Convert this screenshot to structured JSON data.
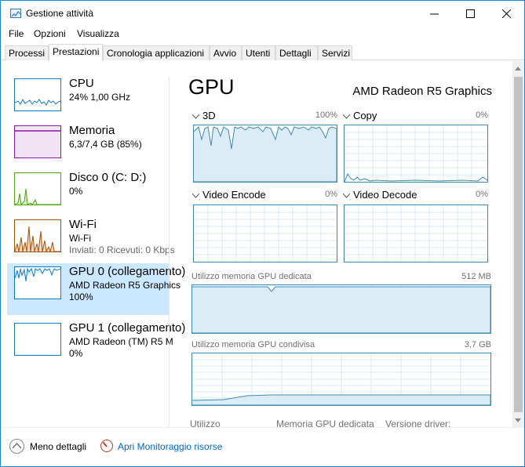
{
  "window": {
    "title": "Gestione attività"
  },
  "menu": [
    "File",
    "Opzioni",
    "Visualizza"
  ],
  "tabs": [
    "Processi",
    "Prestazioni",
    "Cronologia applicazioni",
    "Avvio",
    "Utenti",
    "Dettagli",
    "Servizi"
  ],
  "active_tab": "Prestazioni",
  "resources": [
    {
      "name": "CPU",
      "line1": "24%  1,00 GHz",
      "line2": "",
      "line3": "",
      "color": "#117dbb"
    },
    {
      "name": "Memoria",
      "line1": "6,3/7,4 GB (85%)",
      "line2": "",
      "line3": "",
      "color": "#8b12ae"
    },
    {
      "name": "Disco 0 (C: D:)",
      "line1": "0%",
      "line2": "",
      "line3": "",
      "color": "#4da60c"
    },
    {
      "name": "Wi-Fi",
      "line1": "Wi-Fi",
      "line2": "Inviati: 0  Ricevuti: 0 Kbps",
      "line3": "",
      "color": "#a74f01"
    },
    {
      "name": "GPU 0 (collegamento)",
      "line1": "AMD Radeon R5 Graphics",
      "line2": "100%",
      "line3": "",
      "color": "#117dbb"
    },
    {
      "name": "GPU 1 (collegamento)",
      "line1": "AMD Radeon (TM) R5 M",
      "line2": "0%",
      "line3": "",
      "color": "#117dbb"
    }
  ],
  "gpu": {
    "title": "GPU",
    "model": "AMD Radeon R5 Graphics",
    "engines": [
      {
        "label": "3D",
        "max": "100%"
      },
      {
        "label": "Copy",
        "max": "0%"
      },
      {
        "label": "Video Encode",
        "max": "0%"
      },
      {
        "label": "Video Decode",
        "max": "0%"
      }
    ],
    "dedicated_label": "Utilizzo memoria GPU dedicata",
    "dedicated_max": "512 MB",
    "shared_label": "Utilizzo memoria GPU condivisa",
    "shared_max": "3,7 GB",
    "stats": [
      "Utilizzo",
      "Memoria GPU dedicata",
      "Versione driver:"
    ]
  },
  "footer": {
    "less_details": "Meno dettagli",
    "monitor_link": "Apri Monitoraggio risorse"
  },
  "colors": {
    "accent": "#1883d7",
    "gpu_line": "#3d8ab0",
    "link": "#0066cc",
    "selected": "#cce8ff"
  }
}
